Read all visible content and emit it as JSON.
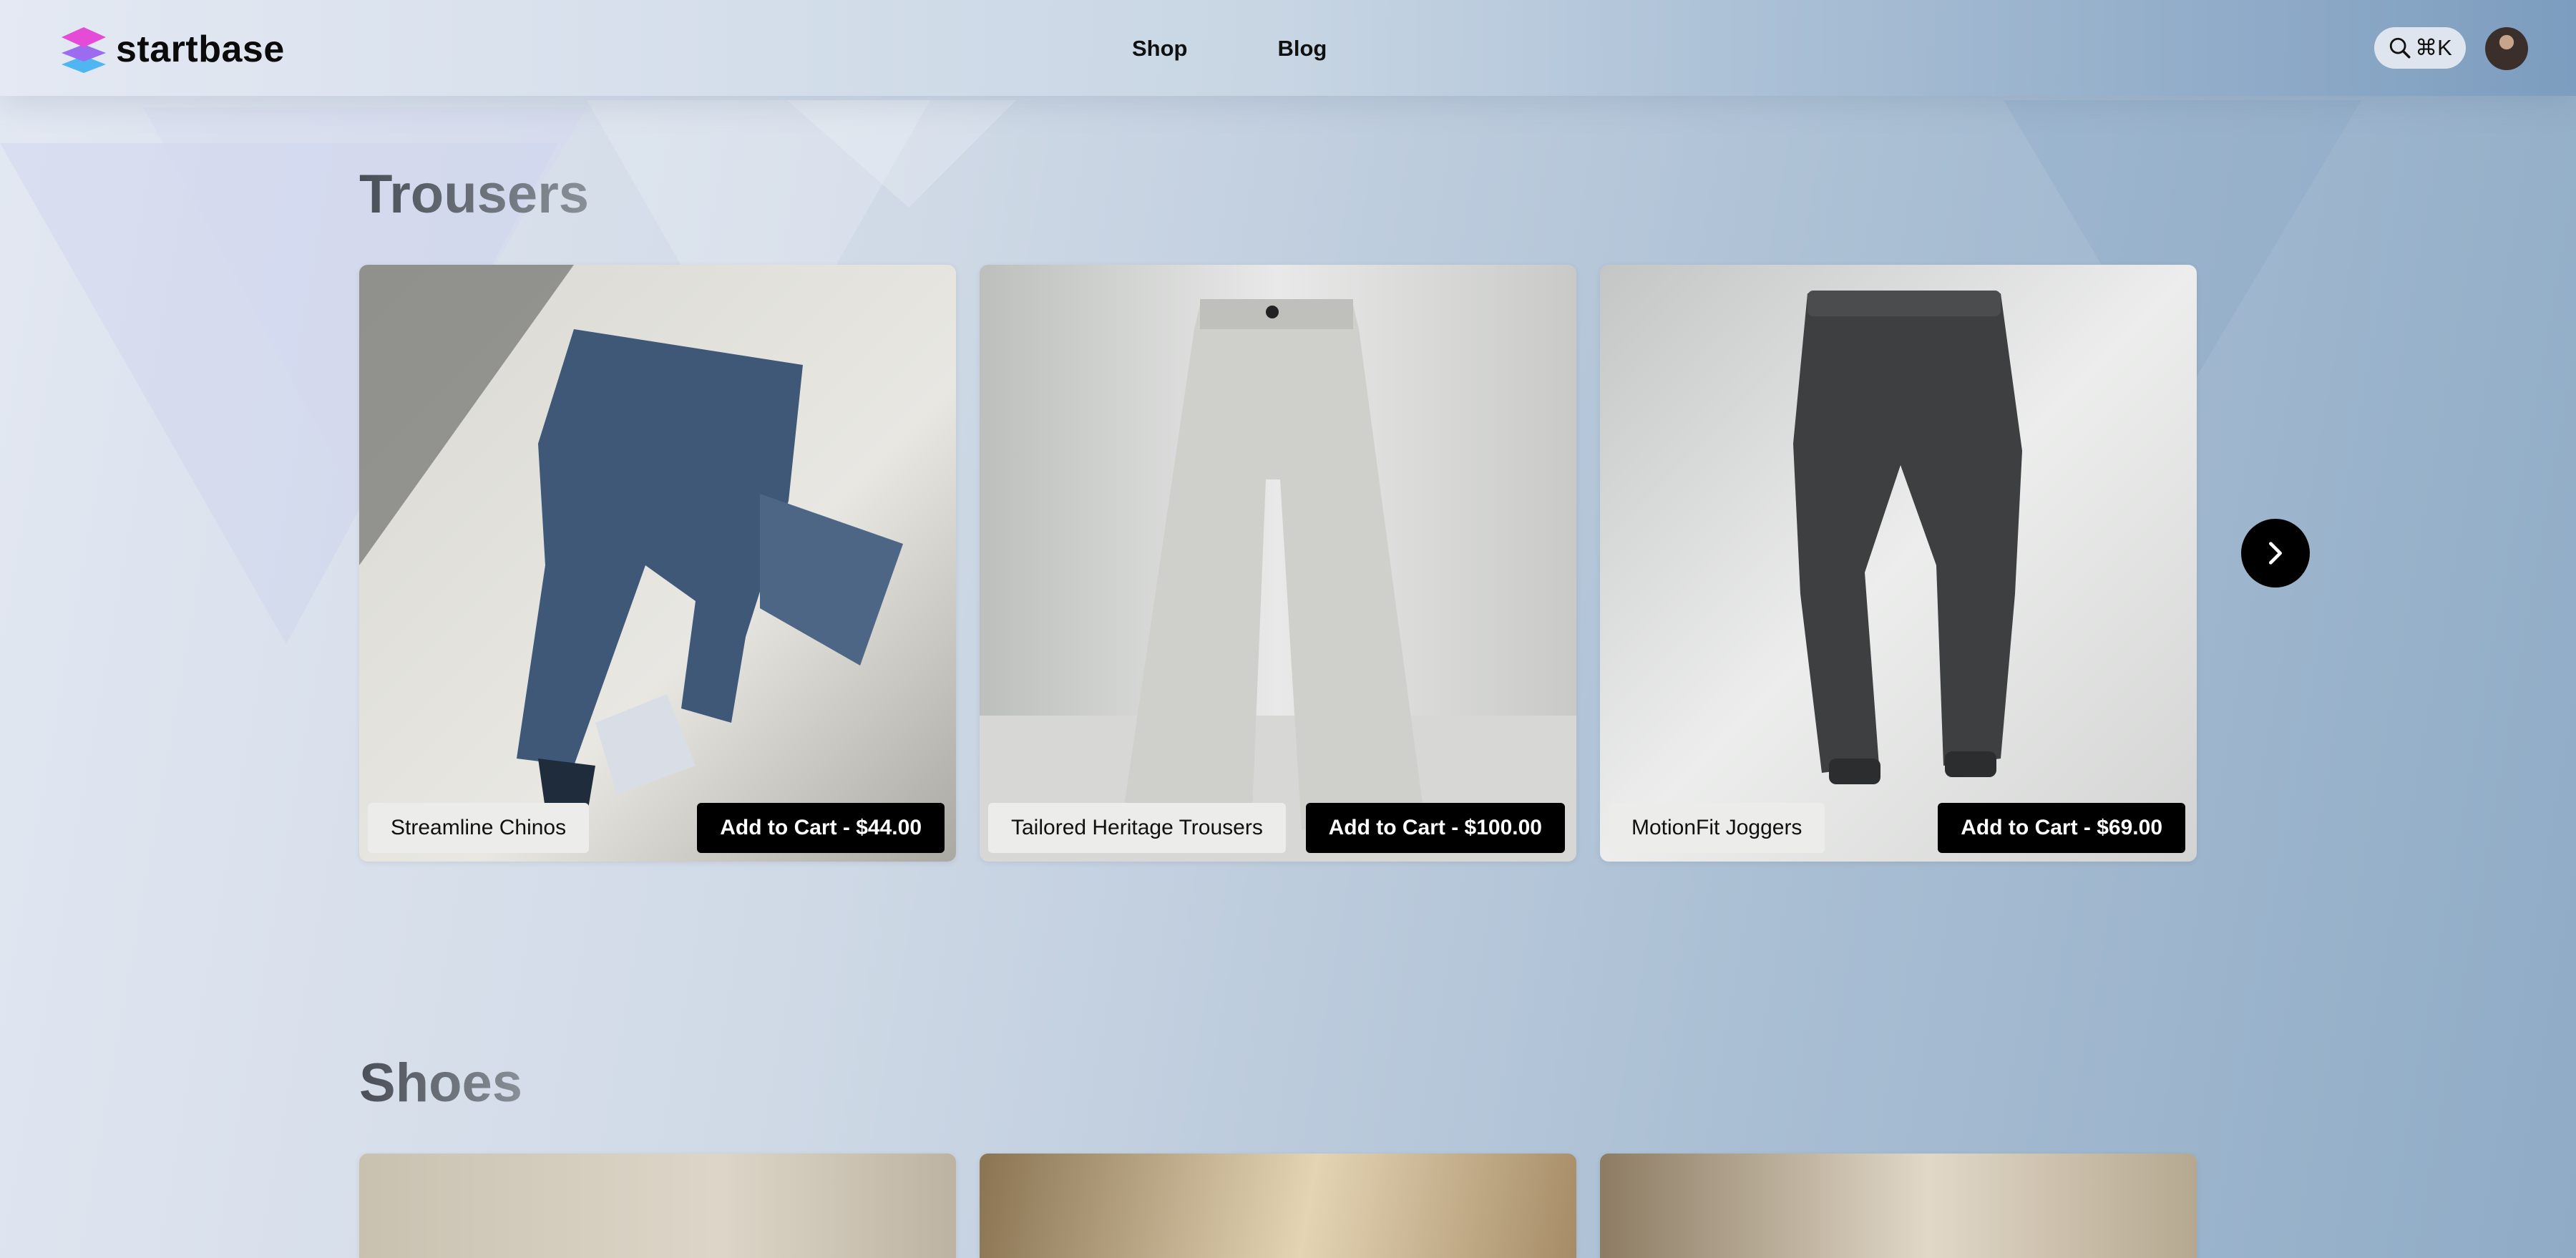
{
  "brand": {
    "name": "startbase"
  },
  "nav": {
    "items": [
      "Shop",
      "Blog"
    ]
  },
  "search": {
    "label": "⌘K"
  },
  "sections": [
    {
      "title": "Trousers",
      "products": [
        {
          "name": "Streamline Chinos",
          "cart_label": "Add to Cart - $44.00"
        },
        {
          "name": "Tailored Heritage Trousers",
          "cart_label": "Add to Cart - $100.00"
        },
        {
          "name": "MotionFit Joggers",
          "cart_label": "Add to Cart - $69.00"
        }
      ]
    },
    {
      "title": "Shoes",
      "products": []
    }
  ],
  "colors": {
    "button_bg": "#000000",
    "tag_bg": "#ececea",
    "logo_accent": "#e64bd8"
  },
  "icons": {
    "search": "search-icon",
    "next": "chevron-right-icon",
    "logo": "layers-icon"
  }
}
